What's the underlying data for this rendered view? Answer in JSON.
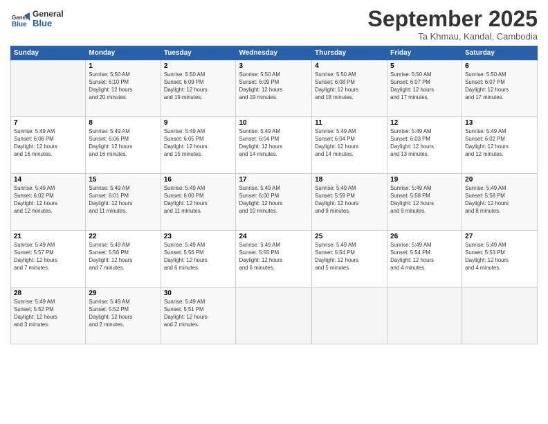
{
  "header": {
    "logo_line1": "General",
    "logo_line2": "Blue",
    "month": "September 2025",
    "location": "Ta Khmau, Kandal, Cambodia"
  },
  "weekdays": [
    "Sunday",
    "Monday",
    "Tuesday",
    "Wednesday",
    "Thursday",
    "Friday",
    "Saturday"
  ],
  "weeks": [
    [
      {
        "num": "",
        "info": ""
      },
      {
        "num": "1",
        "info": "Sunrise: 5:50 AM\nSunset: 6:10 PM\nDaylight: 12 hours\nand 20 minutes."
      },
      {
        "num": "2",
        "info": "Sunrise: 5:50 AM\nSunset: 6:09 PM\nDaylight: 12 hours\nand 19 minutes."
      },
      {
        "num": "3",
        "info": "Sunrise: 5:50 AM\nSunset: 6:09 PM\nDaylight: 12 hours\nand 19 minutes."
      },
      {
        "num": "4",
        "info": "Sunrise: 5:50 AM\nSunset: 6:08 PM\nDaylight: 12 hours\nand 18 minutes."
      },
      {
        "num": "5",
        "info": "Sunrise: 5:50 AM\nSunset: 6:07 PM\nDaylight: 12 hours\nand 17 minutes."
      },
      {
        "num": "6",
        "info": "Sunrise: 5:50 AM\nSunset: 6:07 PM\nDaylight: 12 hours\nand 17 minutes."
      }
    ],
    [
      {
        "num": "7",
        "info": "Sunrise: 5:49 AM\nSunset: 6:06 PM\nDaylight: 12 hours\nand 16 minutes."
      },
      {
        "num": "8",
        "info": "Sunrise: 5:49 AM\nSunset: 6:06 PM\nDaylight: 12 hours\nand 16 minutes."
      },
      {
        "num": "9",
        "info": "Sunrise: 5:49 AM\nSunset: 6:05 PM\nDaylight: 12 hours\nand 15 minutes."
      },
      {
        "num": "10",
        "info": "Sunrise: 5:49 AM\nSunset: 6:04 PM\nDaylight: 12 hours\nand 14 minutes."
      },
      {
        "num": "11",
        "info": "Sunrise: 5:49 AM\nSunset: 6:04 PM\nDaylight: 12 hours\nand 14 minutes."
      },
      {
        "num": "12",
        "info": "Sunrise: 5:49 AM\nSunset: 6:03 PM\nDaylight: 12 hours\nand 13 minutes."
      },
      {
        "num": "13",
        "info": "Sunrise: 5:49 AM\nSunset: 6:02 PM\nDaylight: 12 hours\nand 12 minutes."
      }
    ],
    [
      {
        "num": "14",
        "info": "Sunrise: 5:49 AM\nSunset: 6:02 PM\nDaylight: 12 hours\nand 12 minutes."
      },
      {
        "num": "15",
        "info": "Sunrise: 5:49 AM\nSunset: 6:01 PM\nDaylight: 12 hours\nand 11 minutes."
      },
      {
        "num": "16",
        "info": "Sunrise: 5:49 AM\nSunset: 6:00 PM\nDaylight: 12 hours\nand 11 minutes."
      },
      {
        "num": "17",
        "info": "Sunrise: 5:49 AM\nSunset: 6:00 PM\nDaylight: 12 hours\nand 10 minutes."
      },
      {
        "num": "18",
        "info": "Sunrise: 5:49 AM\nSunset: 5:59 PM\nDaylight: 12 hours\nand 9 minutes."
      },
      {
        "num": "19",
        "info": "Sunrise: 5:49 AM\nSunset: 5:58 PM\nDaylight: 12 hours\nand 9 minutes."
      },
      {
        "num": "20",
        "info": "Sunrise: 5:49 AM\nSunset: 5:58 PM\nDaylight: 12 hours\nand 8 minutes."
      }
    ],
    [
      {
        "num": "21",
        "info": "Sunrise: 5:49 AM\nSunset: 5:57 PM\nDaylight: 12 hours\nand 7 minutes."
      },
      {
        "num": "22",
        "info": "Sunrise: 5:49 AM\nSunset: 5:56 PM\nDaylight: 12 hours\nand 7 minutes."
      },
      {
        "num": "23",
        "info": "Sunrise: 5:49 AM\nSunset: 5:56 PM\nDaylight: 12 hours\nand 6 minutes."
      },
      {
        "num": "24",
        "info": "Sunrise: 5:49 AM\nSunset: 5:55 PM\nDaylight: 12 hours\nand 6 minutes."
      },
      {
        "num": "25",
        "info": "Sunrise: 5:49 AM\nSunset: 5:54 PM\nDaylight: 12 hours\nand 5 minutes."
      },
      {
        "num": "26",
        "info": "Sunrise: 5:49 AM\nSunset: 5:54 PM\nDaylight: 12 hours\nand 4 minutes."
      },
      {
        "num": "27",
        "info": "Sunrise: 5:49 AM\nSunset: 5:53 PM\nDaylight: 12 hours\nand 4 minutes."
      }
    ],
    [
      {
        "num": "28",
        "info": "Sunrise: 5:49 AM\nSunset: 5:52 PM\nDaylight: 12 hours\nand 3 minutes."
      },
      {
        "num": "29",
        "info": "Sunrise: 5:49 AM\nSunset: 5:52 PM\nDaylight: 12 hours\nand 2 minutes."
      },
      {
        "num": "30",
        "info": "Sunrise: 5:49 AM\nSunset: 5:51 PM\nDaylight: 12 hours\nand 2 minutes."
      },
      {
        "num": "",
        "info": ""
      },
      {
        "num": "",
        "info": ""
      },
      {
        "num": "",
        "info": ""
      },
      {
        "num": "",
        "info": ""
      }
    ]
  ]
}
